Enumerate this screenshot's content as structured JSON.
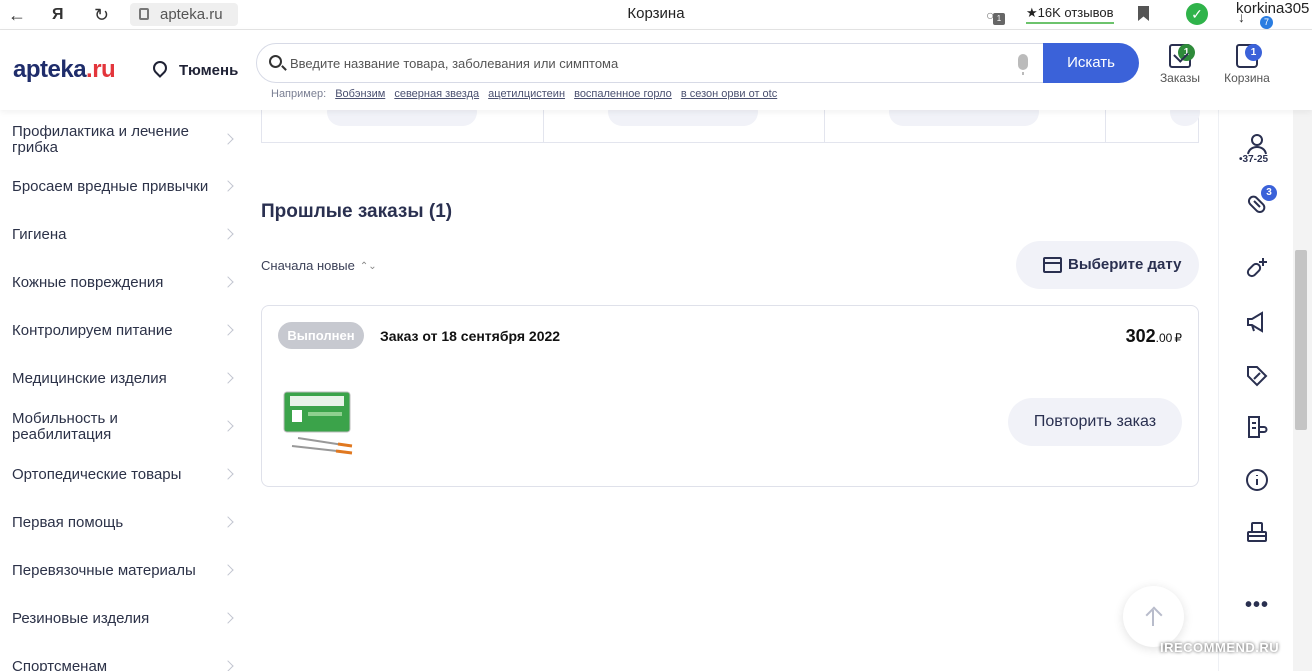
{
  "browser": {
    "url": "apteka.ru",
    "page_title": "Корзина",
    "reviews": "★16K отзывов",
    "user": "korkina305",
    "ext_badge": "1",
    "download_badge": "7"
  },
  "header": {
    "logo_main": "apteka",
    "logo_suffix": ".ru",
    "city": "Тюмень",
    "search_placeholder": "Введите название товара, заболевания или симптома",
    "search_button": "Искать",
    "examples_label": "Например:",
    "examples": [
      "Вобэнзим",
      "северная звезда",
      "ацетилцистеин",
      "воспаленное горло",
      "в сезон орви от otc"
    ],
    "orders_label": "Заказы",
    "orders_count": "1",
    "cart_label": "Корзина",
    "cart_count": "1",
    "orders_badge_color": "#2e8b3a",
    "cart_badge_color": "#3b62d9"
  },
  "sidebar": {
    "categories": [
      "Профилактика и лечение грибка",
      "Бросаем вредные привычки",
      "Гигиена",
      "Кожные повреждения",
      "Контролируем питание",
      "Медицинские изделия",
      "Мобильность и реабилитация",
      "Ортопедические товары",
      "Первая помощь",
      "Перевязочные материалы",
      "Резиновые изделия",
      "Спортсменам"
    ]
  },
  "main": {
    "section_title": "Прошлые заказы (1)",
    "sort_label": "Сначала новые",
    "date_button": "Выберите дату",
    "order": {
      "status": "Выполнен",
      "title": "Заказ от 18 сентября 2022",
      "price_main": "302",
      "price_cents": ".00",
      "currency": "₽",
      "repeat_button": "Повторить заказ"
    }
  },
  "rail": {
    "phone_suffix": "•37-25",
    "pills_badge": "3"
  },
  "watermark": "IRECOMMEND.RU"
}
